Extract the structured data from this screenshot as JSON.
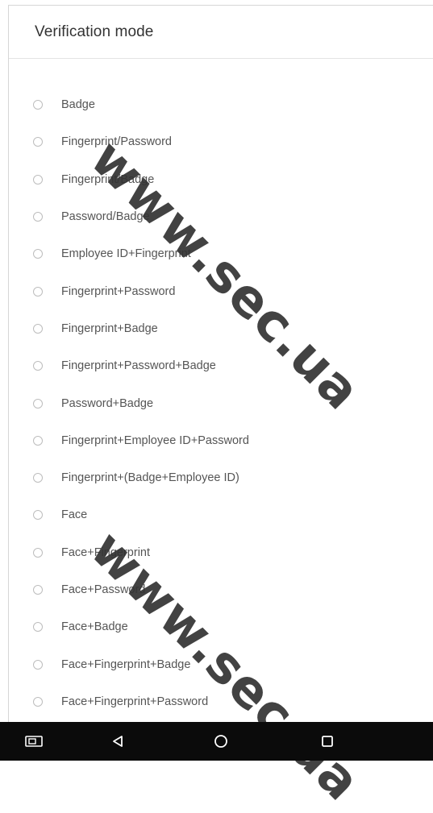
{
  "title": "Verification mode",
  "options": [
    "Badge",
    "Fingerprint/Password",
    "Fingerprint/Badge",
    "Password/Badge",
    "Employee ID+Fingerprint",
    "Fingerprint+Password",
    "Fingerprint+Badge",
    "Fingerprint+Password+Badge",
    "Password+Badge",
    "Fingerprint+Employee ID+Password",
    "Fingerprint+(Badge+Employee ID)",
    "Face",
    "Face+Fingerprint",
    "Face+Password",
    "Face+Badge",
    "Face+Fingerprint+Badge",
    "Face+Fingerprint+Password"
  ],
  "watermark": "www.sec.ua",
  "icons": {
    "screenshot": "screenshot-icon",
    "back": "back-icon",
    "home": "home-icon",
    "recents": "recents-icon"
  }
}
